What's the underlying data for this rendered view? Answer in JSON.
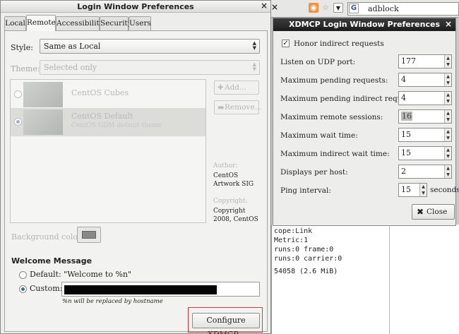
{
  "main_window": {
    "title": "Login Window Preferences",
    "close": "×",
    "tabs": [
      "Local",
      "Remote",
      "Accessibility",
      "Security",
      "Users"
    ],
    "style_label": "Style:",
    "style_value": "Same as Local",
    "theme_label": "Theme:",
    "theme_value": "Selected only",
    "themes": [
      {
        "name": "CentOS Cubes",
        "description": ""
      },
      {
        "name": "CentOS Default",
        "description": "CentOS GDM default theme"
      }
    ],
    "add_label": "Add...",
    "remove_label": "Remove...",
    "author_label": "Author:",
    "author_value": "CentOS Artwork SIG",
    "copyright_label": "Copyright:",
    "copyright_value": "Copyright 2008, CentOS",
    "background_colour_label": "Background colour:",
    "welcome_heading": "Welcome Message",
    "default_option": "Default: \"Welcome to %n\"",
    "custom_option": "Custom:",
    "hint": "%n will be replaced by hostname",
    "configure_button": "Configure XDMCP..."
  },
  "browser": {
    "search_text": "adblock",
    "rss_icon": "rss-icon",
    "star_icon": "star-icon",
    "google_icon": "G"
  },
  "terminal": {
    "lines": [
      "cope:Link",
      " Metric:1",
      "runs:0 frame:0",
      "runs:0 carrier:0",
      "",
      "54058 (2.6 MiB)"
    ]
  },
  "xdmcp": {
    "title": "XDMCP Login Window Preferences",
    "close": "×",
    "honor_indirect": "Honor indirect requests",
    "rows": [
      {
        "label": "Listen on UDP port:",
        "value": "177"
      },
      {
        "label": "Maximum pending requests:",
        "value": "4"
      },
      {
        "label": "Maximum pending indirect requests:",
        "value": "4"
      },
      {
        "label": "Maximum remote sessions:",
        "value": "16"
      },
      {
        "label": "Maximum wait time:",
        "value": "15"
      },
      {
        "label": "Maximum indirect wait time:",
        "value": "15"
      },
      {
        "label": "Displays per host:",
        "value": "2"
      }
    ],
    "ping_label": "Ping interval:",
    "ping_value": "15",
    "ping_unit": "seconds",
    "close_button": "Close"
  }
}
